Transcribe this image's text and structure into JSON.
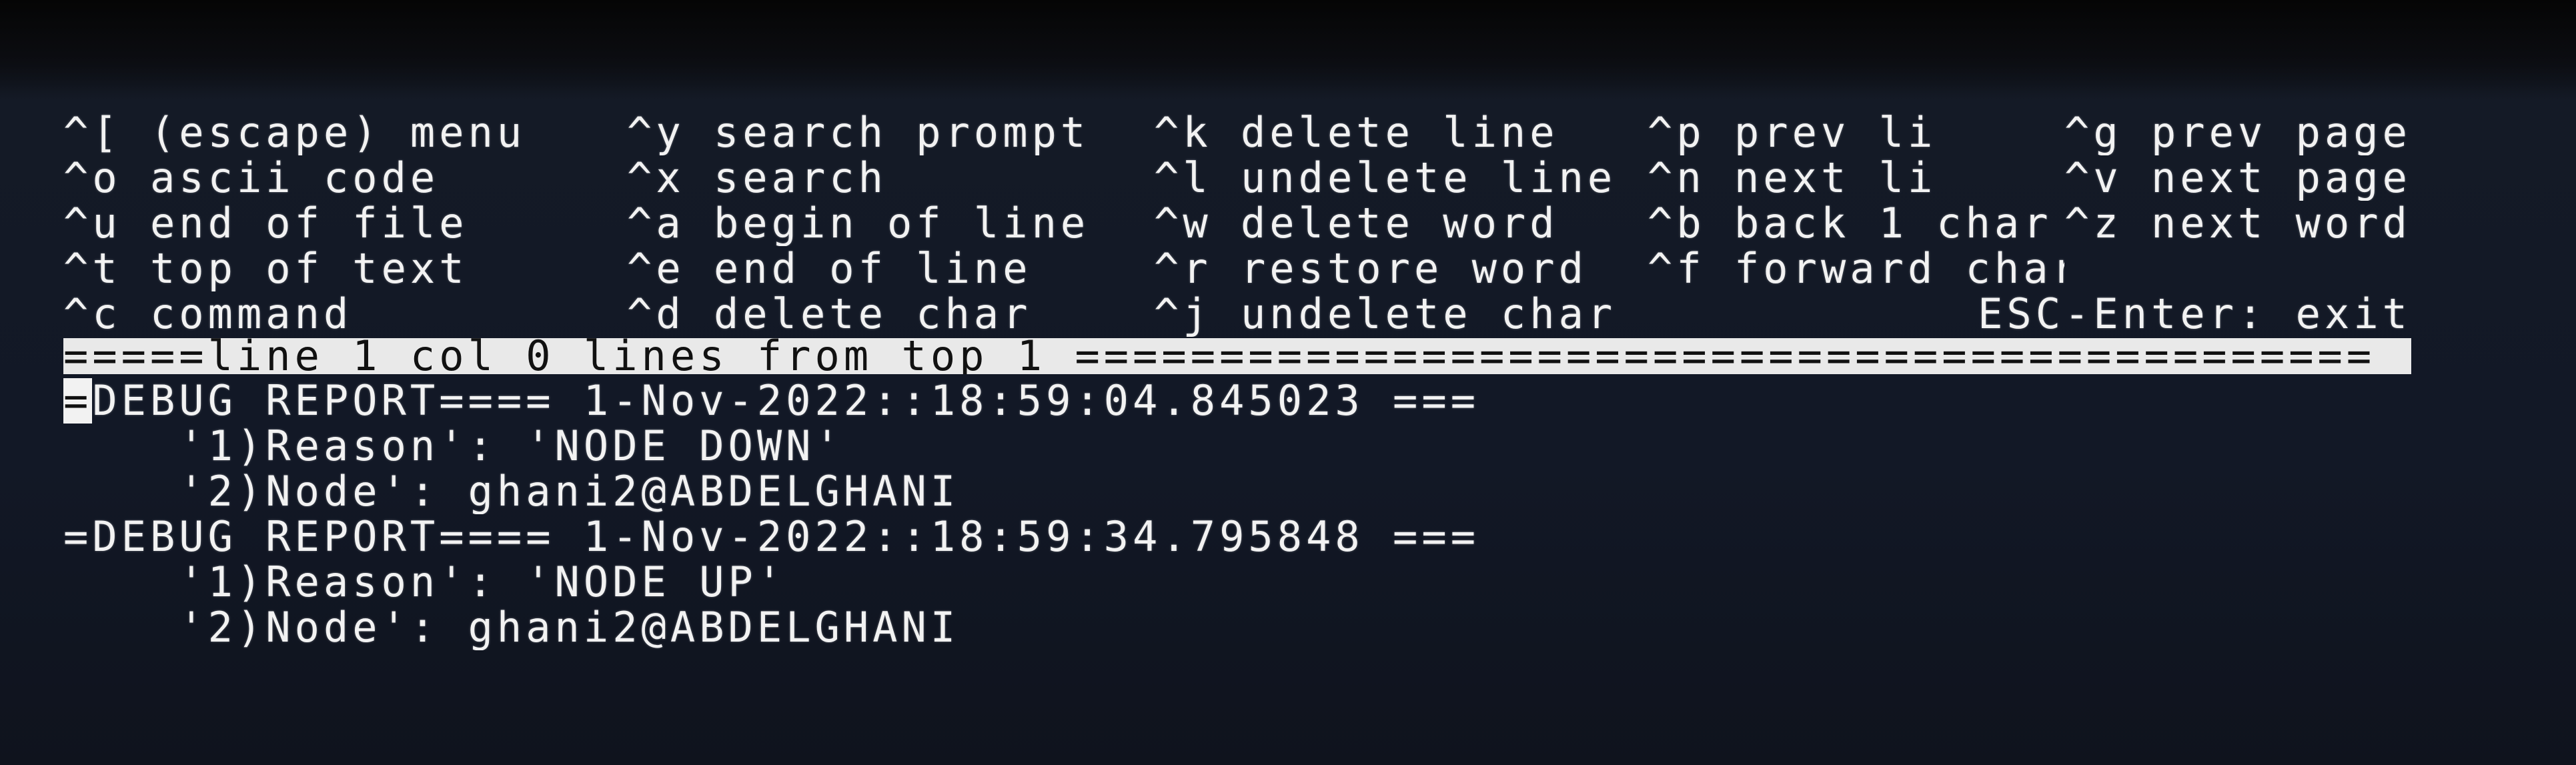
{
  "help": {
    "rows": [
      [
        "^[ (escape) menu",
        "^y search prompt",
        "^k delete line",
        "^p prev li",
        "^g prev page"
      ],
      [
        "^o ascii code",
        "^x search",
        "^l undelete line",
        "^n next li",
        "^v next page"
      ],
      [
        "^u end of file",
        "^a begin of line",
        "^w delete word",
        "^b back 1 char",
        "^z next word"
      ],
      [
        "^t top of text",
        "^e end of line",
        "^r restore word",
        "^f forward char",
        ""
      ],
      [
        "^c command",
        "^d delete char",
        "^j undelete char",
        "",
        ""
      ]
    ],
    "exit_hint": "ESC-Enter: exit"
  },
  "status": {
    "text": "=====line 1 col 0 lines from top 1 ============================================="
  },
  "content": {
    "cursor_char": "=",
    "first_line_rest": "DEBUG REPORT==== 1-Nov-2022::18:59:04.845023 ===",
    "lines": [
      "    '1)Reason': 'NODE DOWN'",
      "    '2)Node': ghani2@ABDELGHANI",
      "=DEBUG REPORT==== 1-Nov-2022::18:59:34.795848 ===",
      "    '1)Reason': 'NODE UP'",
      "    '2)Node': ghani2@ABDELGHANI"
    ]
  }
}
